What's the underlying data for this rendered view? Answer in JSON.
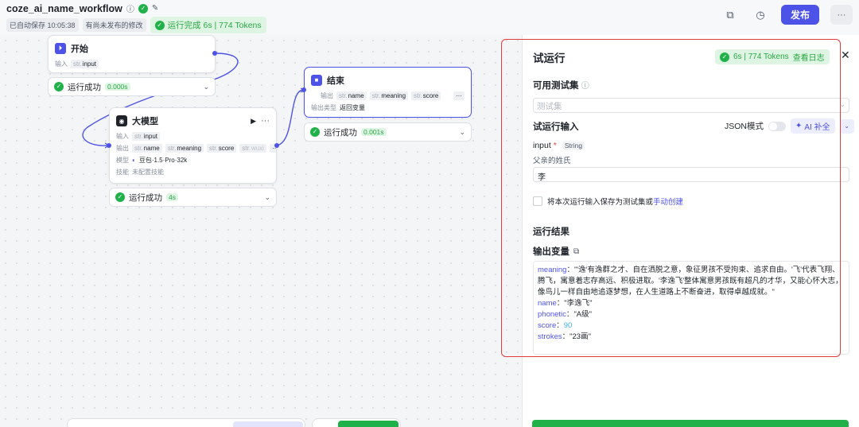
{
  "workflow": {
    "name": "coze_ai_name_workflow",
    "autosave": "已自动保存 10:05:38",
    "unpublished": "有尚未发布的修改",
    "run_status": "运行完成 6s | 774 Tokens"
  },
  "toolbar": {
    "publish_label": "发布",
    "more_label": "···"
  },
  "nodes": {
    "start": {
      "title": "开始",
      "input_label": "输入",
      "input_tag_type": "str.",
      "input_tag_name": "input",
      "status_label": "运行成功",
      "status_time": "0.000s"
    },
    "llm": {
      "title": "大模型",
      "input_label": "输入",
      "input_tag_type": "str.",
      "input_tag_name": "input",
      "output_label": "输出",
      "outputs": [
        {
          "type": "str.",
          "name": "name"
        },
        {
          "type": "str.",
          "name": "meaning"
        },
        {
          "type": "str.",
          "name": "score"
        },
        {
          "type": "str.",
          "name": "wuxi"
        }
      ],
      "model_label": "模型",
      "model_value": "豆包·1.5·Pro·32k",
      "skill_label": "技能",
      "skill_value": "未配置技能",
      "status_label": "运行成功",
      "status_time": "4s"
    },
    "end": {
      "title": "结束",
      "output_label": "输出",
      "outputs": [
        {
          "type": "str.",
          "name": "name"
        },
        {
          "type": "str.",
          "name": "meaning"
        },
        {
          "type": "str.",
          "name": "score"
        }
      ],
      "output_type_label": "输出类型",
      "output_type_value": "返回变量",
      "status_label": "运行成功",
      "status_time": "0.001s"
    }
  },
  "panel": {
    "title": "试运行",
    "stat": "6s | 774 Tokens",
    "log_link": "查看日志",
    "test_set_heading": "可用测试集",
    "test_set_placeholder": "测试集",
    "run_input_heading": "试运行输入",
    "json_mode_label": "JSON模式",
    "ai_fill_label": "AI 补全",
    "field_name": "input",
    "field_required": "*",
    "field_type": "String",
    "field_hint": "父亲的姓氏",
    "field_value": "李",
    "save_checkbox_label": "将本次运行输入保存为测试集或",
    "manual_create_link": "手动创建",
    "result_heading": "运行结果",
    "output_var_heading": "输出变量",
    "output": {
      "meaning_key": "meaning",
      "meaning_value": "\"'逸'有逸群之才、自在洒脱之意，象征男孩不受拘束、追求自由。'飞'代表飞翔、腾飞，寓意着志存高远、积极进取。'李逸飞'整体寓意男孩既有超凡的才华，又能心怀大志，像鸟儿一样自由地追逐梦想，在人生道路上不断奋进，取得卓越成就。\"",
      "name_key": "name",
      "name_value": "\"李逸飞\"",
      "phonetic_key": "phonetic",
      "phonetic_value": "\"A级\"",
      "score_key": "score",
      "score_value": "90",
      "strokes_key": "strokes",
      "strokes_value": "\"23画\""
    }
  },
  "colors": {
    "accent": "#4e53e8",
    "success": "#21b14a",
    "highlight_frame": "#e03c3c"
  }
}
